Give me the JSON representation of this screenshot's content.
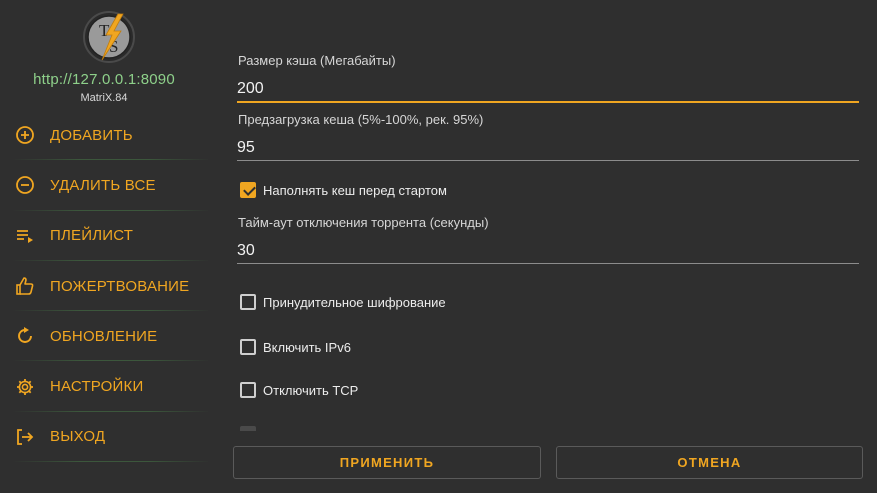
{
  "sidebar": {
    "logo_letters": "TS",
    "host": "http://127.0.0.1:8090",
    "version": "MatriX.84",
    "items": [
      {
        "label": "ДОБАВИТЬ",
        "icon": "plus-circle-icon"
      },
      {
        "label": "УДАЛИТЬ ВСЕ",
        "icon": "minus-circle-icon"
      },
      {
        "label": "ПЛЕЙЛИСТ",
        "icon": "playlist-icon"
      },
      {
        "label": "ПОЖЕРТВОВАНИЕ",
        "icon": "thumbs-up-icon"
      },
      {
        "label": "ОБНОВЛЕНИЕ",
        "icon": "refresh-icon"
      },
      {
        "label": "НАСТРОЙКИ",
        "icon": "gear-icon"
      },
      {
        "label": "ВЫХОД",
        "icon": "exit-icon"
      }
    ]
  },
  "settings": {
    "cache_size": {
      "label": "Размер кэша (Мегабайты)",
      "value": "200"
    },
    "preload": {
      "label": "Предзагрузка кеша (5%-100%, рек. 95%)",
      "value": "95"
    },
    "fill_cache": {
      "label": "Наполнять кеш перед стартом",
      "checked": true
    },
    "timeout": {
      "label": "Тайм-аут отключения торрента (секунды)",
      "value": "30"
    },
    "force_encryption": {
      "label": "Принудительное шифрование",
      "checked": false
    },
    "enable_ipv6": {
      "label": "Включить IPv6",
      "checked": false
    },
    "disable_tcp": {
      "label": "Отключить TCP",
      "checked": false
    }
  },
  "buttons": {
    "apply": "ПРИМЕНИТЬ",
    "cancel": "ОТМЕНА"
  },
  "colors": {
    "accent": "#f0a621",
    "background": "#2f2f2f",
    "host_text": "#8ed08a"
  }
}
